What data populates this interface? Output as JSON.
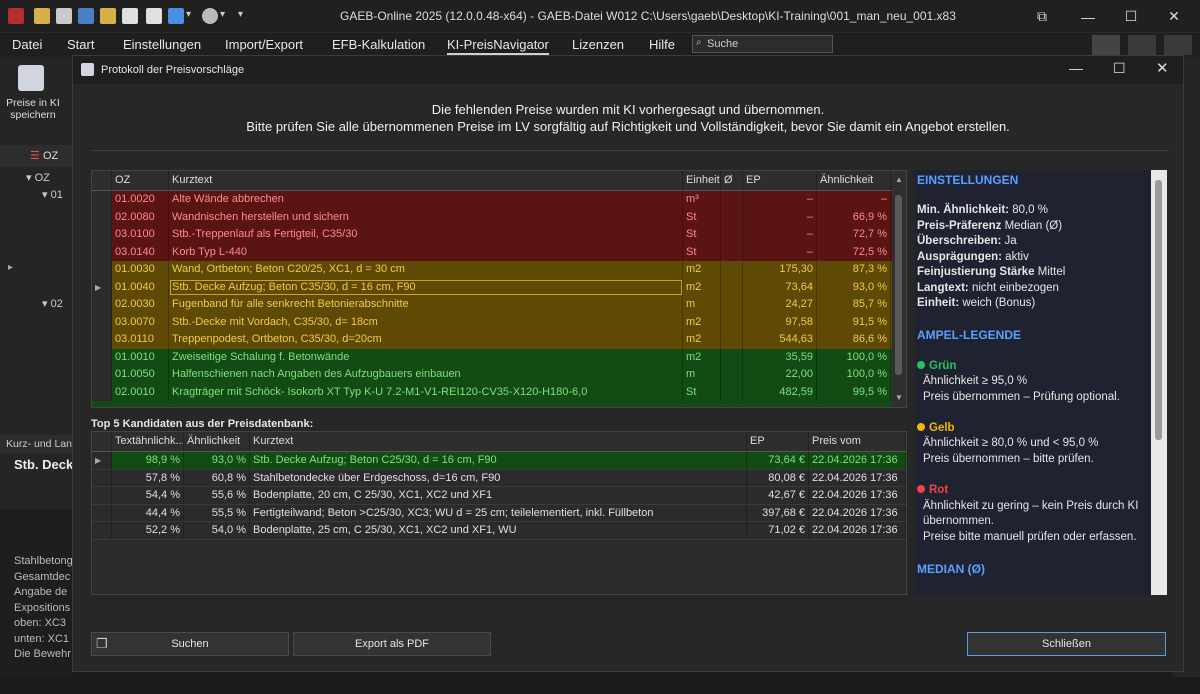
{
  "window": {
    "title": "GAEB-Online 2025 (12.0.0.48-x64) - GAEB-Datei  W012 C:\\Users\\gaeb\\Desktop\\KI-Training\\001_man_neu_001.x83"
  },
  "menu": {
    "items": [
      "Datei",
      "Start",
      "Einstellungen",
      "Import/Export",
      "EFB-Kalkulation",
      "KI-PreisNavigator",
      "Lizenzen",
      "Hilfe"
    ],
    "search_placeholder": "Suche"
  },
  "background": {
    "ribbon_button": "Preise in KI speichern",
    "ribbon_button_line1": "Preise in KI",
    "ribbon_button_line2": "speichern",
    "oz_label": "OZ",
    "tree_oz": "OZ",
    "tree_01": "01",
    "tree_02": "02",
    "tab_label": "Kurz- und Lang",
    "long_title": "Stb. Deck",
    "long_lines": [
      "Stahlbetong",
      "Gesamtdec",
      "Angabe de",
      "",
      "Expositions",
      "oben: XC3",
      "unten: XC1",
      "",
      "Die Bewehr"
    ]
  },
  "dialog": {
    "title": "Protokoll der Preisvorschläge",
    "message_line1": "Die fehlenden Preise wurden mit KI vorhergesagt und übernommen.",
    "message_line2": "Bitte prüfen Sie alle übernommenen Preise im LV sorgfältig auf Richtigkeit und Vollständigkeit, bevor Sie damit ein Angebot erstellen.",
    "main_table": {
      "headers": [
        "OZ",
        "Kurztext",
        "Einheit",
        "Ø",
        "EP",
        "Ähnlichkeit"
      ],
      "rows": [
        {
          "oz": "01.0020",
          "text": "Alte Wände abbrechen",
          "unit": "m³",
          "ep": "–",
          "sim": "–",
          "status": "red"
        },
        {
          "oz": "02.0080",
          "text": "Wandnischen herstellen und sichern",
          "unit": "St",
          "ep": "–",
          "sim": "66,9 %",
          "status": "red"
        },
        {
          "oz": "03.0100",
          "text": "Stb.-Treppenlauf als Fertigteil, C35/30",
          "unit": "St",
          "ep": "–",
          "sim": "72,7 %",
          "status": "red"
        },
        {
          "oz": "03.0140",
          "text": "Korb Typ L-440",
          "unit": "St",
          "ep": "–",
          "sim": "72,5 %",
          "status": "red"
        },
        {
          "oz": "01.0030",
          "text": "Wand, Ortbeton; Beton C20/25, XC1, d = 30 cm",
          "unit": "m2",
          "ep": "175,30",
          "sim": "87,3 %",
          "status": "yellow"
        },
        {
          "oz": "01.0040",
          "text": "Stb. Decke Aufzug; Beton C35/30, d = 16 cm, F90",
          "unit": "m2",
          "ep": "73,64",
          "sim": "93,0 %",
          "status": "yellow",
          "selected": true
        },
        {
          "oz": "02.0030",
          "text": "Fugenband für alle senkrecht Betonierabschnitte",
          "unit": "m",
          "ep": "24,27",
          "sim": "85,7 %",
          "status": "yellow"
        },
        {
          "oz": "03.0070",
          "text": "Stb.-Decke mit Vordach, C35/30, d= 18cm",
          "unit": "m2",
          "ep": "97,58",
          "sim": "91,5 %",
          "status": "yellow"
        },
        {
          "oz": "03.0110",
          "text": "Treppenpodest, Ortbeton, C35/30, d=20cm",
          "unit": "m2",
          "ep": "544,63",
          "sim": "86,6 %",
          "status": "yellow"
        },
        {
          "oz": "01.0010",
          "text": "Zweiseitige Schalung f. Betonwände",
          "unit": "m2",
          "ep": "35,59",
          "sim": "100,0 %",
          "status": "green"
        },
        {
          "oz": "01.0050",
          "text": "Halfenschienen nach Angaben des Aufzugbauers einbauen",
          "unit": "m",
          "ep": "22,00",
          "sim": "100,0 %",
          "status": "green"
        },
        {
          "oz": "02.0010",
          "text": "Kragträger mit Schöck- Isokorb XT Typ K-U 7.2-M1-V1-REI120-CV35-X120-H180-6,0",
          "unit": "St",
          "ep": "482,59",
          "sim": "99,5 %",
          "status": "green"
        }
      ]
    },
    "top5": {
      "title": "Top 5 Kandidaten aus der Preisdatenbank:",
      "headers": [
        "Textähnlichk...",
        "Ähnlichkeit",
        "Kurztext",
        "EP",
        "Preis vom"
      ],
      "rows": [
        {
          "textsim": "98,9 %",
          "sim": "93,0 %",
          "text": "Stb. Decke Aufzug; Beton C25/30, d = 16 cm, F90",
          "ep": "73,64 €",
          "date": "22.04.2026 17:36",
          "highlight": true
        },
        {
          "textsim": "57,8 %",
          "sim": "60,8 %",
          "text": "Stahlbetondecke über Erdgeschoss, d=16 cm, F90",
          "ep": "80,08 €",
          "date": "22.04.2026 17:36"
        },
        {
          "textsim": "54,4 %",
          "sim": "55,6 %",
          "text": "Bodenplatte, 20 cm, C 25/30, XC1, XC2 und XF1",
          "ep": "42,67 €",
          "date": "22.04.2026 17:36"
        },
        {
          "textsim": "44,4 %",
          "sim": "55,5 %",
          "text": "Fertigteilwand; Beton >C25/30, XC3; WU d = 25 cm; teilelementiert, inkl. Füllbeton",
          "ep": "397,68 €",
          "date": "22.04.2026 17:36"
        },
        {
          "textsim": "52,2 %",
          "sim": "54,0 %",
          "text": "Bodenplatte, 25 cm, C 25/30, XC1, XC2 und XF1, WU",
          "ep": "71,02 €",
          "date": "22.04.2026 17:36"
        }
      ]
    },
    "settings": {
      "heading": "EINSTELLUNGEN",
      "lines": [
        {
          "k": "Min. Ähnlichkeit:",
          "v": " 80,0 %"
        },
        {
          "k": "Preis-Präferenz",
          "v": " Median (Ø)"
        },
        {
          "k": "Überschreiben:",
          "v": " Ja"
        },
        {
          "k": "Ausprägungen:",
          "v": " aktiv"
        },
        {
          "k": "Feinjustierung Stärke",
          "v": " Mittel"
        },
        {
          "k": "Langtext:",
          "v": " nicht einbezogen"
        },
        {
          "k": "Einheit:",
          "v": " weich (Bonus)"
        }
      ],
      "legend_heading": "AMPEL-LEGENDE",
      "green_title": "Grün",
      "green_l1": "Ähnlichkeit ≥ 95,0 %",
      "green_l2": "Preis übernommen – Prüfung optional.",
      "yellow_title": "Gelb",
      "yellow_l1": "Ähnlichkeit ≥ 80,0 % und < 95,0 %",
      "yellow_l2": "Preis übernommen – bitte prüfen.",
      "red_title": "Rot",
      "red_l1": "Ähnlichkeit zu gering – kein Preis durch KI",
      "red_l2": "übernommen.",
      "red_l3": "Preise bitte manuell prüfen oder erfassen.",
      "median_heading": "MEDIAN  (Ø)",
      "colors": {
        "green": "#22c55e",
        "yellow": "#f5b700",
        "red": "#ef4444",
        "heading": "#5aa0ff"
      }
    },
    "buttons": {
      "search": "Suchen",
      "export": "Export als PDF",
      "close": "Schließen"
    }
  }
}
